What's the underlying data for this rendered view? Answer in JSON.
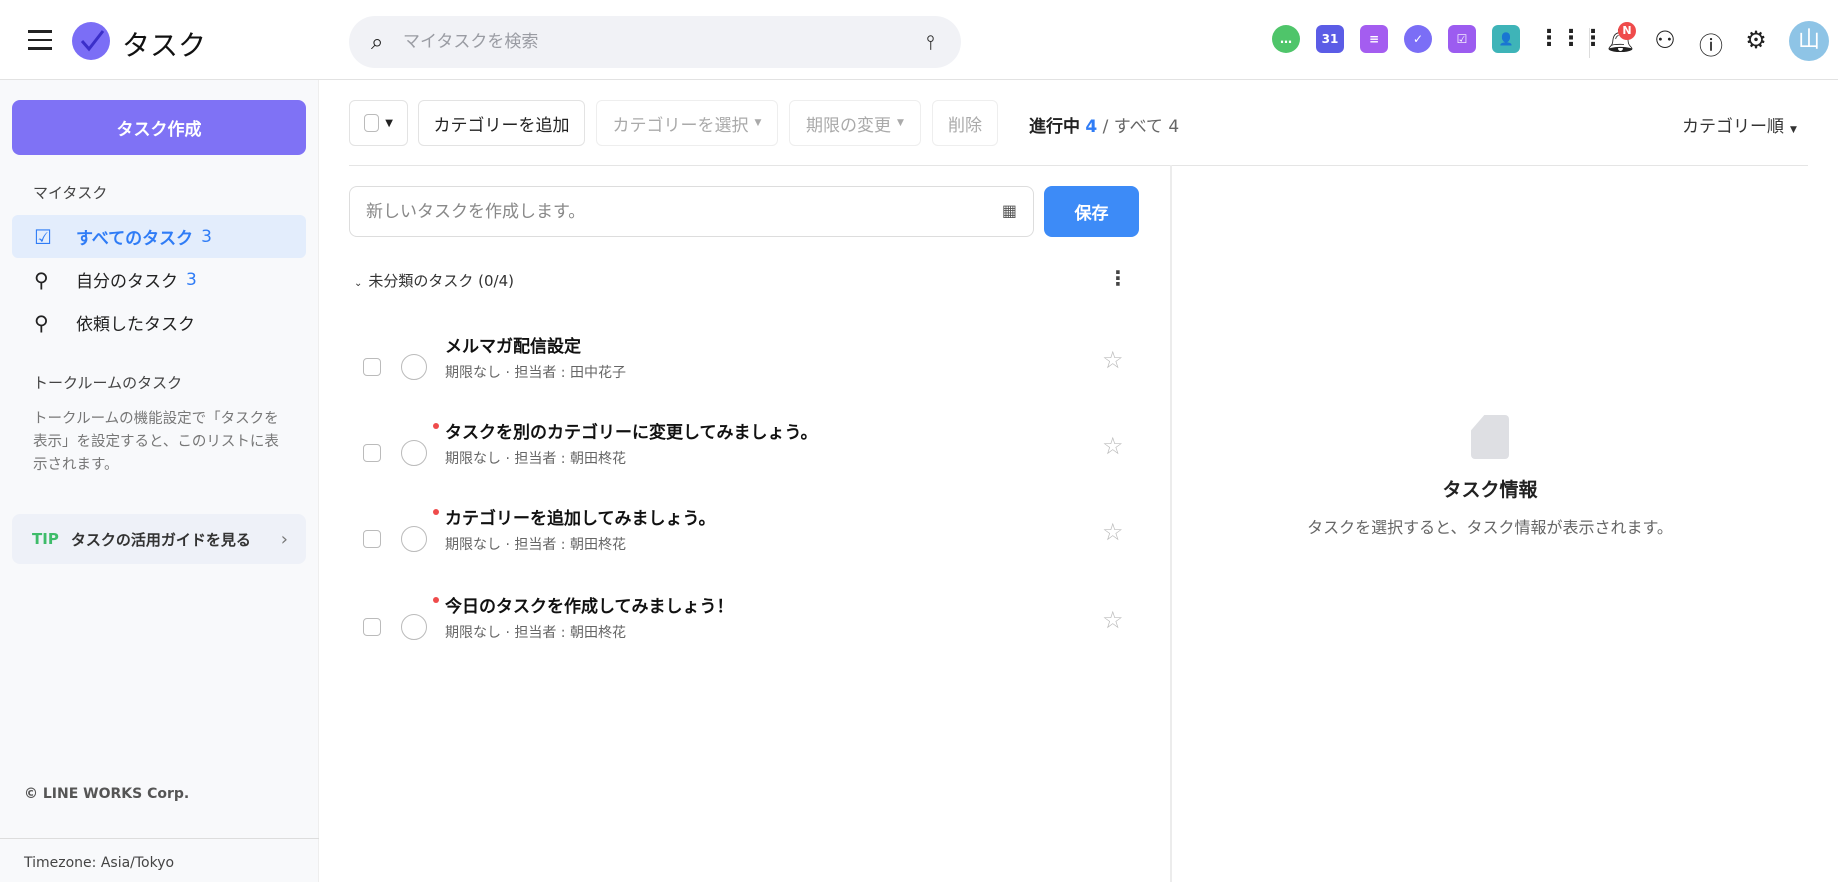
{
  "header": {
    "title": "タスク",
    "search_placeholder": "マイタスクを検索",
    "notification_badge": "N",
    "avatar": "山",
    "apps": [
      {
        "name": "chat-icon",
        "color": "#4fc56a",
        "glyph": "…"
      },
      {
        "name": "calendar-icon",
        "color": "#5b5ce6",
        "glyph": "31"
      },
      {
        "name": "note-icon",
        "color": "#a45df0",
        "glyph": "≡"
      },
      {
        "name": "task-icon",
        "color": "#7b6ef6",
        "glyph": "✓"
      },
      {
        "name": "approval-icon",
        "color": "#9c5cf0",
        "glyph": "☑"
      },
      {
        "name": "contacts-icon",
        "color": "#3eb4b8",
        "glyph": "👤"
      }
    ]
  },
  "sidebar": {
    "create_label": "タスク作成",
    "section_my": "マイタスク",
    "items": [
      {
        "label": "すべてのタスク",
        "count": "3"
      },
      {
        "label": "自分のタスク",
        "count": "3"
      },
      {
        "label": "依頼したタスク"
      }
    ],
    "section_talk": "トークルームのタスク",
    "talk_desc": "トークルームの機能設定で「タスクを表示」を設定すると、このリストに表示されます。",
    "tip_label": "TIP",
    "tip_text": "タスクの活用ガイドを見る",
    "copyright": "© LINE WORKS Corp.",
    "timezone": "Timezone: Asia/Tokyo"
  },
  "toolbar": {
    "add_category": "カテゴリーを追加",
    "select_category": "カテゴリーを選択",
    "change_due": "期限の変更",
    "delete": "削除",
    "in_progress_label": "進行中",
    "in_progress_count": "4",
    "all_label": "/ すべて",
    "all_count": "4",
    "sort": "カテゴリー順"
  },
  "new_task": {
    "placeholder": "新しいタスクを作成します。",
    "save": "保存"
  },
  "group": {
    "label": "未分類のタスク (0/4)"
  },
  "tasks": [
    {
      "title": "メルマガ配信設定",
      "meta": "期限なし · 担当者 : 田中花子",
      "new": false
    },
    {
      "title": "タスクを別のカテゴリーに変更してみましょう。",
      "meta": "期限なし · 担当者 : 朝田柊花",
      "new": true
    },
    {
      "title": "カテゴリーを追加してみましょう。",
      "meta": "期限なし · 担当者 : 朝田柊花",
      "new": true
    },
    {
      "title": "今日のタスクを作成してみましょう！",
      "meta": "期限なし · 担当者 : 朝田柊花",
      "new": true
    }
  ],
  "detail": {
    "title": "タスク情報",
    "subtitle": "タスクを選択すると、タスク情報が表示されます。"
  }
}
